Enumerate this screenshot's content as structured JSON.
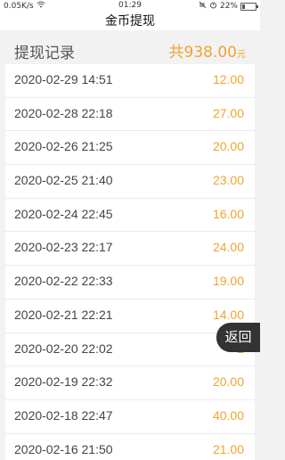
{
  "status_bar": {
    "network_speed": "0.05K/s",
    "time": "01:29",
    "battery": "22%",
    "battery_level": 0.22,
    "icons": [
      "wifi-icon",
      "mute-icon",
      "alarm-icon",
      "battery-icon"
    ]
  },
  "title": "金币提现",
  "list": {
    "header": "提现记录",
    "total_prefix": "共",
    "total_value": "938.00",
    "total_unit": "元",
    "rows": [
      {
        "date": "2020-02-29 14:51",
        "amount": "12.00"
      },
      {
        "date": "2020-02-28 22:18",
        "amount": "27.00"
      },
      {
        "date": "2020-02-26 21:25",
        "amount": "20.00"
      },
      {
        "date": "2020-02-25 21:40",
        "amount": "23.00"
      },
      {
        "date": "2020-02-24 22:45",
        "amount": "16.00"
      },
      {
        "date": "2020-02-23 22:17",
        "amount": "24.00"
      },
      {
        "date": "2020-02-22 22:33",
        "amount": "19.00"
      },
      {
        "date": "2020-02-21 22:21",
        "amount": "14.00"
      },
      {
        "date": "2020-02-20 22:02",
        "amount": "2"
      },
      {
        "date": "2020-02-19 22:32",
        "amount": "20.00"
      },
      {
        "date": "2020-02-18 22:47",
        "amount": "40.00"
      },
      {
        "date": "2020-02-16 21:50",
        "amount": "21.00"
      }
    ]
  },
  "back_label": "返回",
  "colors": {
    "accent": "#f0a32e",
    "text": "#444444",
    "back_bg": "#333333"
  }
}
